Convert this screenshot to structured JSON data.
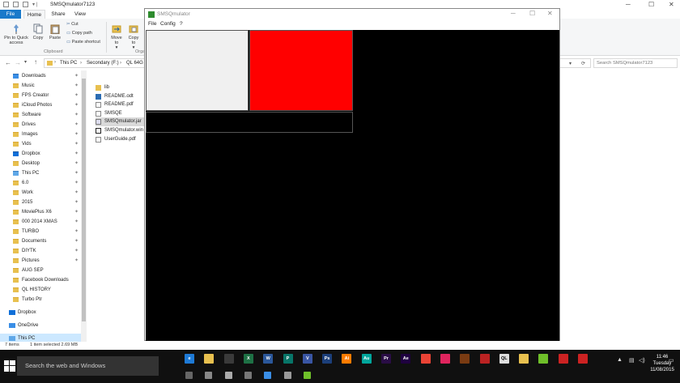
{
  "explorer": {
    "title": "SMSQmulator7123",
    "tabs": {
      "file": "File",
      "home": "Home",
      "share": "Share",
      "view": "View"
    },
    "ribbon": {
      "pin_quick_access": "Pin to Quick access",
      "copy": "Copy",
      "paste": "Paste",
      "cut": "Cut",
      "copy_path": "Copy path",
      "paste_shortcut": "Paste shortcut",
      "move_to": "Move to",
      "copy_to": "Copy to",
      "clipboard_group": "Clipboard",
      "organize_group": "Orga"
    },
    "breadcrumb": [
      "This PC",
      "Secondary (F:)",
      "QL 64G"
    ],
    "search_placeholder": "Search SMSQmulator7123",
    "nav_items": [
      {
        "label": "Downloads",
        "pinned": true
      },
      {
        "label": "Music",
        "pinned": true
      },
      {
        "label": "FPS Creator",
        "pinned": true
      },
      {
        "label": "iCloud Photos",
        "pinned": true
      },
      {
        "label": "Software",
        "pinned": true
      },
      {
        "label": "Drives",
        "pinned": true
      },
      {
        "label": "Images",
        "pinned": true
      },
      {
        "label": "Vids",
        "pinned": true
      },
      {
        "label": "Dropbox",
        "pinned": true
      },
      {
        "label": "Desktop",
        "pinned": true
      },
      {
        "label": "This PC",
        "pinned": true
      },
      {
        "label": "6.0",
        "pinned": true
      },
      {
        "label": "Work",
        "pinned": true
      },
      {
        "label": "2015",
        "pinned": true
      },
      {
        "label": "MoviePlus X6",
        "pinned": true
      },
      {
        "label": "000 2014 XMAS",
        "pinned": true
      },
      {
        "label": "TURBO",
        "pinned": true
      },
      {
        "label": "Documents",
        "pinned": true
      },
      {
        "label": "DIYTK",
        "pinned": true
      },
      {
        "label": "Pictures",
        "pinned": true
      },
      {
        "label": "AUG SEP",
        "pinned": false
      },
      {
        "label": "Facebook Downloads",
        "pinned": false
      },
      {
        "label": "QL HISTORY",
        "pinned": false
      },
      {
        "label": "Turbo Ptr",
        "pinned": false
      }
    ],
    "nav_bottom": [
      {
        "label": "Dropbox"
      },
      {
        "label": "OneDrive"
      },
      {
        "label": "This PC"
      }
    ],
    "files": [
      {
        "name": "lib",
        "type": "folder"
      },
      {
        "name": "README.odt",
        "type": "doc"
      },
      {
        "name": "README.pdf",
        "type": "pdf"
      },
      {
        "name": "SMSQE",
        "type": "file"
      },
      {
        "name": "SMSQmulator.jar",
        "type": "jar"
      },
      {
        "name": "SMSQmulator.win",
        "type": "ql"
      },
      {
        "name": "UserGuide.pdf",
        "type": "pdf"
      }
    ],
    "status": {
      "items": "7 items",
      "selected": "1 item selected  2.69 MB"
    }
  },
  "smsq": {
    "title": "SMSQmulator",
    "menu": [
      "File",
      "Config",
      "?"
    ],
    "colors": {
      "red_pane": "#ff0000",
      "white_pane": "#f0f0f0",
      "screen": "#000000"
    }
  },
  "taskbar": {
    "search_text": "Search the web and Windows",
    "time": "11:46",
    "day": "Tuesday",
    "date": "11/08/2015",
    "apps": [
      "edge-icon",
      "explorer-icon",
      "store-icon",
      "excel-icon",
      "word-icon",
      "publisher-icon",
      "visio-icon",
      "photoshop-icon",
      "illustrator-icon",
      "audition-icon",
      "premiere-icon",
      "aftereffects-icon",
      "chrome-icon",
      "itunes-icon",
      "app-icon",
      "app-icon",
      "ql-icon",
      "app-icon",
      "app-icon",
      "app-icon",
      "app-icon"
    ]
  }
}
